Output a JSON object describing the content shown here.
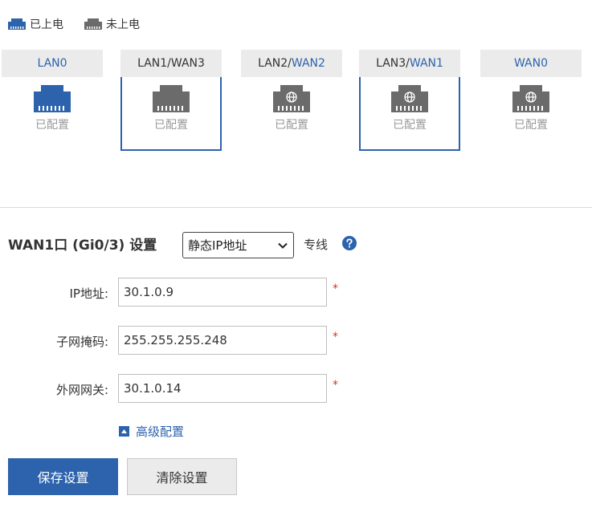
{
  "legend": {
    "powered": "已上电",
    "unpowered": "未上电",
    "powered_color": "#2d63ad",
    "unpowered_color": "#6b6b6b"
  },
  "ports": [
    {
      "name_parts": [
        "LAN0"
      ],
      "status": "已配置",
      "selected": false,
      "powered": true,
      "icon": "ethernet-port-icon"
    },
    {
      "name_parts": [
        "LAN1",
        "/",
        "WAN3"
      ],
      "status": "已配置",
      "selected": true,
      "powered": false,
      "icon": "ethernet-port-icon"
    },
    {
      "name_parts": [
        "LAN2",
        "/",
        "WAN2"
      ],
      "status": "已配置",
      "selected": false,
      "powered": false,
      "icon": "ethernet-globe-icon"
    },
    {
      "name_parts": [
        "LAN3",
        "/",
        "WAN1"
      ],
      "status": "已配置",
      "selected": true,
      "powered": false,
      "icon": "ethernet-globe-icon"
    },
    {
      "name_parts": [
        "WAN0"
      ],
      "status": "已配置",
      "selected": false,
      "powered": false,
      "icon": "ethernet-globe-icon"
    }
  ],
  "form": {
    "title": "WAN1口 (Gi0/3) 设置",
    "connection_type": "静态IP地址",
    "dedicated_label": "专线",
    "ip_label": "IP地址:",
    "ip_value": "30.1.0.9",
    "mask_label": "子网掩码:",
    "mask_value": "255.255.255.248",
    "gateway_label": "外网网关:",
    "gateway_value": "30.1.0.14",
    "required_mark": "*",
    "advanced_label": "高级配置",
    "save_label": "保存设置",
    "clear_label": "清除设置"
  }
}
